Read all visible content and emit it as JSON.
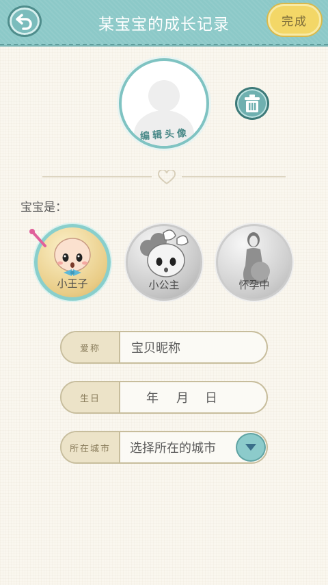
{
  "header": {
    "title": "某宝宝的成长记录",
    "done_label": "完成"
  },
  "avatar": {
    "edit_label": "编辑头像"
  },
  "baby_type": {
    "prompt": "宝宝是：",
    "options": [
      {
        "label": "小王子",
        "selected": true
      },
      {
        "label": "小公主",
        "selected": false
      },
      {
        "label": "怀孕中",
        "selected": false
      }
    ]
  },
  "form": {
    "nickname": {
      "label": "爱称",
      "value": "宝贝昵称"
    },
    "birthday": {
      "label": "生日",
      "year": "年",
      "month": "月",
      "day": "日"
    },
    "city": {
      "label": "所在城市",
      "value": "选择所在的城市"
    }
  },
  "icons": {
    "back": "back-arrow-icon",
    "trash": "trash-icon",
    "heart": "heart-icon",
    "dropdown": "chevron-down-icon"
  },
  "colors": {
    "header_bg": "#8cc9c8",
    "done_bg": "#f3d767",
    "accent": "#7fc3c2",
    "page_bg": "#faf7ef"
  }
}
